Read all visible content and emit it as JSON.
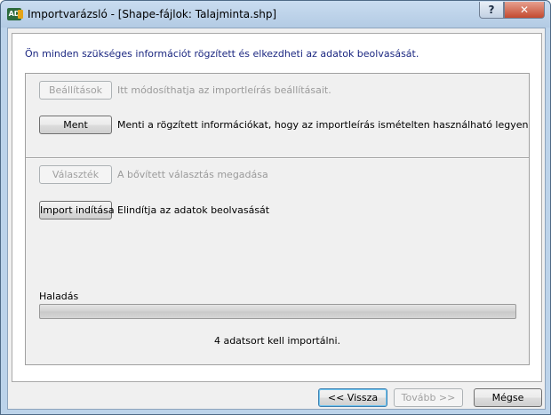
{
  "window": {
    "title": "Importvarázsló - [Shape-fájlok: Talajminta.shp]",
    "icon_text": "AD",
    "help_label": "?",
    "close_label": "✕"
  },
  "intro_text": "Ön minden szükséges információt rögzített és elkezdheti az adatok beolvasását.",
  "actions": {
    "settings": {
      "label": "Beállítások",
      "description": "Itt módosíthatja az importleírás beállításait.",
      "enabled": false
    },
    "save": {
      "label": "Ment",
      "description": "Menti a rögzített információkat, hogy az importleírás ismételten használható legyen",
      "enabled": true
    },
    "selection": {
      "label": "Választék",
      "description": "A bővített választás megadása",
      "enabled": false
    },
    "start_import": {
      "label": "Import indítása",
      "description": "Elindítja az adatok beolvasását",
      "enabled": true
    }
  },
  "progress": {
    "label": "Haladás",
    "value": 0,
    "status_text": "4 adatsort kell importálni."
  },
  "footer": {
    "back_label": "<< Vissza",
    "next_label": "Tovább >>",
    "cancel_label": "Mégse"
  },
  "colors": {
    "intro_text": "#1a2680",
    "title_bar": "#bcd3ea"
  }
}
